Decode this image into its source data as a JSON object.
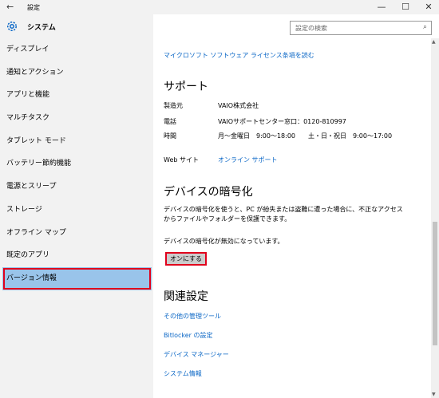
{
  "window": {
    "title": "設定",
    "back_glyph": "←",
    "minimize_glyph": "—",
    "maximize_glyph": "☐",
    "close_glyph": "✕"
  },
  "header": {
    "label": "システム"
  },
  "search": {
    "placeholder": "設定の検索",
    "icon_glyph": "⌕"
  },
  "sidebar": {
    "items": [
      {
        "label": "ディスプレイ"
      },
      {
        "label": "通知とアクション"
      },
      {
        "label": "アプリと機能"
      },
      {
        "label": "マルチタスク"
      },
      {
        "label": "タブレット モード"
      },
      {
        "label": "バッテリー節約機能"
      },
      {
        "label": "電源とスリープ"
      },
      {
        "label": "ストレージ"
      },
      {
        "label": "オフライン マップ"
      },
      {
        "label": "既定のアプリ"
      },
      {
        "label": "バージョン情報"
      }
    ]
  },
  "main": {
    "top_link": "マイクロソフト ソフトウェア ライセンス条項を読む",
    "support": {
      "heading": "サポート",
      "rows": [
        {
          "k": "製造元",
          "v": "VAIO株式会社"
        },
        {
          "k": "電話",
          "v": "VAIOサポートセンター窓口：0120-810997"
        },
        {
          "k": "時間",
          "v": "月～金曜日　9:00～18:00　　土・日・祝日　9:00～17:00"
        },
        {
          "k": "Web サイト",
          "v": "オンライン サポート"
        }
      ]
    },
    "encryption": {
      "heading": "デバイスの暗号化",
      "description": "デバイスの暗号化を使うと、PC が紛失または盗難に遭った場合に、不正なアクセスからファイルやフォルダーを保護できます。",
      "status": "デバイスの暗号化が無効になっています。",
      "button": "オンにする"
    },
    "related": {
      "heading": "関連設定",
      "links": [
        "その他の管理ツール",
        "Bitlocker の設定",
        "デバイス マネージャー",
        "システム情報"
      ]
    }
  },
  "colors": {
    "accent": "#0b67c6",
    "highlight": "#e0001c",
    "selected": "#99c4ea"
  }
}
